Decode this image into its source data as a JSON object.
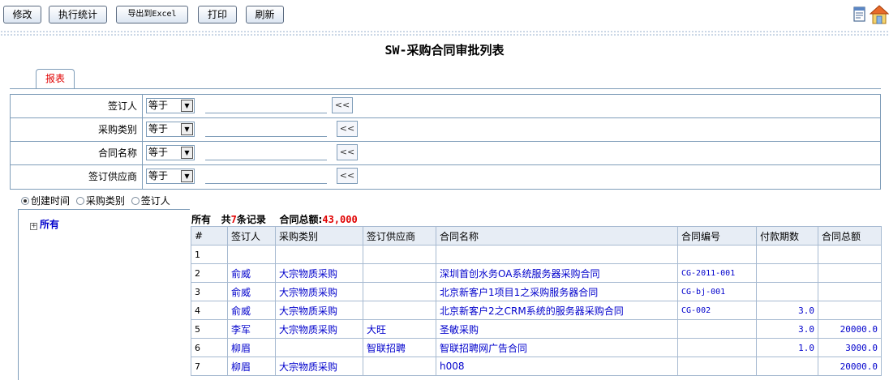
{
  "toolbar": {
    "buttons": [
      "修改",
      "执行统计",
      "导出到Excel",
      "打印",
      "刷新"
    ]
  },
  "page_title": "SW-采购合同审批列表",
  "tab_label": "报表",
  "filters": [
    {
      "label": "签订人",
      "op": "等于",
      "value": "",
      "btn": "<<"
    },
    {
      "label": "采购类别",
      "op": "等于",
      "value": "",
      "btn": "<<"
    },
    {
      "label": "合同名称",
      "op": "等于",
      "value": "",
      "btn": "<<"
    },
    {
      "label": "签订供应商",
      "op": "等于",
      "value": "",
      "btn": "<<"
    }
  ],
  "group_options": [
    {
      "label": "创建时间",
      "selected": true
    },
    {
      "label": "采购类别",
      "selected": false
    },
    {
      "label": "签订人",
      "selected": false
    }
  ],
  "tree": {
    "root": "所有"
  },
  "summary": {
    "scope": "所有",
    "count_prefix": "共",
    "count": "7",
    "count_suffix": "条记录",
    "total_label": "合同总额:",
    "total_value": "43,000"
  },
  "table": {
    "headers": [
      "#",
      "签订人",
      "采购类别",
      "签订供应商",
      "合同名称",
      "合同编号",
      "付款期数",
      "合同总额"
    ],
    "rows": [
      [
        "1",
        "",
        "",
        "",
        "",
        "",
        "",
        ""
      ],
      [
        "2",
        "俞威",
        "大宗物质采购",
        "",
        "深圳首创水务OA系统服务器采购合同",
        "CG-2011-001",
        "",
        ""
      ],
      [
        "3",
        "俞威",
        "大宗物质采购",
        "",
        "北京新客户1项目1之采购服务器合同",
        "CG-bj-001",
        "",
        ""
      ],
      [
        "4",
        "俞威",
        "大宗物质采购",
        "",
        "北京新客户2之CRM系统的服务器采购合同",
        "CG-002",
        "3.0",
        ""
      ],
      [
        "5",
        "李军",
        "大宗物质采购",
        "大旺",
        "圣敏采购",
        "",
        "3.0",
        "20000.0"
      ],
      [
        "6",
        "柳眉",
        "",
        "智联招聘",
        "智联招聘网广告合同",
        "",
        "1.0",
        "3000.0"
      ],
      [
        "7",
        "柳眉",
        "大宗物质采购",
        "",
        "h008",
        "",
        "",
        "20000.0"
      ]
    ]
  }
}
